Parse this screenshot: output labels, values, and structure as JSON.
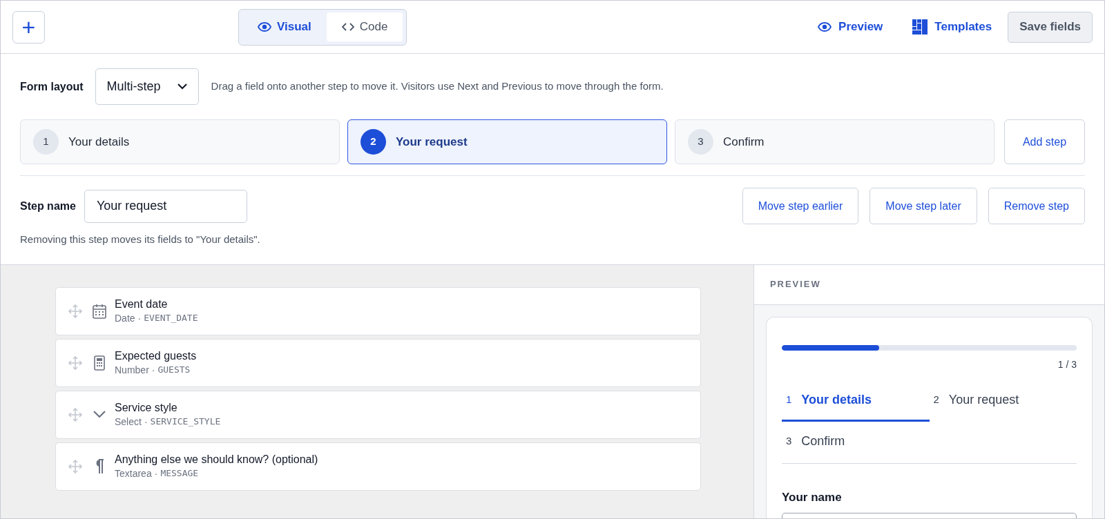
{
  "toolbar": {
    "add_button": "+",
    "modes": [
      {
        "label": "Visual",
        "selected": true
      },
      {
        "label": "Code",
        "selected": false
      }
    ],
    "actions": [
      {
        "label": "Preview"
      },
      {
        "label": "Templates"
      }
    ],
    "save_button": "Save fields"
  },
  "form_layout": {
    "label": "Form layout",
    "value": "Multi-step",
    "hint": "Drag a field onto another step to move it. Visitors use Next and Previous to move through the form."
  },
  "steps": [
    {
      "number": "1",
      "label": "Your details",
      "selected": false
    },
    {
      "number": "2",
      "label": "Your request",
      "selected": true
    },
    {
      "number": "3",
      "label": "Confirm",
      "selected": false
    }
  ],
  "add_step": "Add step",
  "step_name": {
    "label": "Step name",
    "value": "Your request",
    "note": "Removing this step moves its fields to \"Your details\"."
  },
  "step_actions": [
    "Move step earlier",
    "Move step later",
    "Remove step"
  ],
  "fields": [
    {
      "kind": "date",
      "label": "Event date",
      "type": "Date",
      "separator": "·",
      "key": "EVENT_DATE"
    },
    {
      "kind": "number",
      "label": "Expected guests",
      "type": "Number",
      "separator": "·",
      "key": "GUESTS"
    },
    {
      "kind": "select",
      "label": "Service style",
      "type": "Select",
      "separator": "·",
      "key": "SERVICE_STYLE"
    },
    {
      "kind": "textarea",
      "label": "Anything else we should know? (optional)",
      "type": "Textarea",
      "separator": "·",
      "key": "MESSAGE"
    }
  ],
  "preview": {
    "heading": "PREVIEW",
    "progress": {
      "level": 0.33,
      "reading": "1 / 3"
    },
    "tabs": [
      {
        "number": "1",
        "label": "Your details",
        "selected": true
      },
      {
        "number": "2",
        "label": "Your request",
        "selected": false
      },
      {
        "number": "3",
        "label": "Confirm",
        "selected": false
      }
    ],
    "first_field_label": "Your name"
  }
}
